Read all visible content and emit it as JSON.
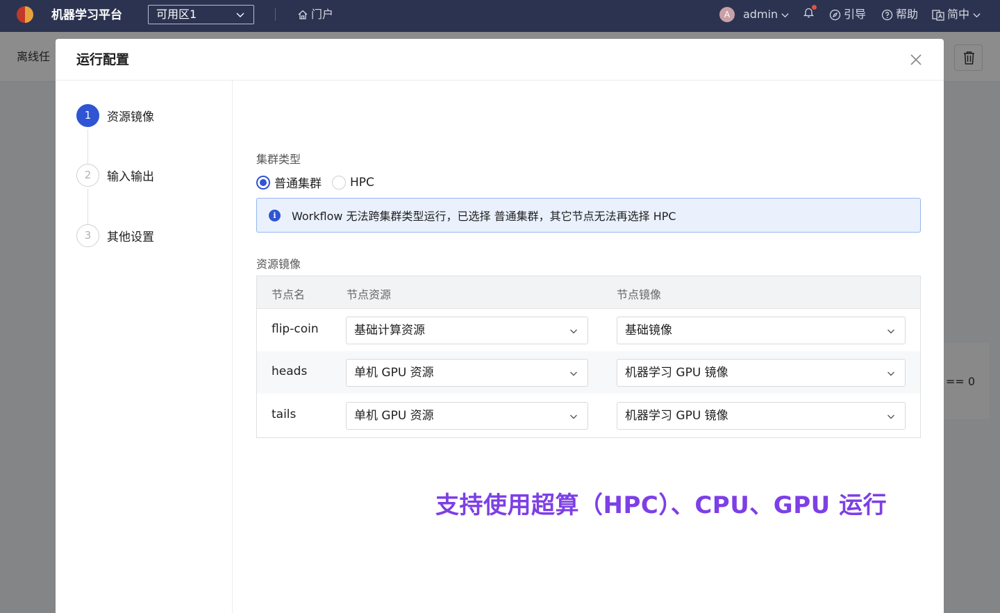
{
  "topbar": {
    "app_title": "机器学习平台",
    "zone": "可用区1",
    "portal": "门户",
    "user": "admin",
    "avatar_letter": "A",
    "guide": "引导",
    "help": "帮助",
    "language": "简中"
  },
  "background": {
    "page_title": "离线任",
    "code_fragment": "== 0"
  },
  "modal": {
    "title": "运行配置",
    "steps": [
      {
        "num": "1",
        "label": "资源镜像",
        "active": true
      },
      {
        "num": "2",
        "label": "输入输出",
        "active": false
      },
      {
        "num": "3",
        "label": "其他设置",
        "active": false
      }
    ],
    "cluster": {
      "label": "集群类型",
      "options": [
        {
          "label": "普通集群",
          "checked": true
        },
        {
          "label": "HPC",
          "checked": false
        }
      ],
      "alert": "Workflow 无法跨集群类型运行，已选择 普通集群，其它节点无法再选择 HPC"
    },
    "resources": {
      "label": "资源镜像",
      "columns": [
        "节点名",
        "节点资源",
        "节点镜像"
      ],
      "rows": [
        {
          "name": "flip-coin",
          "resource": "基础计算资源",
          "image": "基础镜像"
        },
        {
          "name": "heads",
          "resource": "单机 GPU 资源",
          "image": "机器学习 GPU 镜像"
        },
        {
          "name": "tails",
          "resource": "单机 GPU 资源",
          "image": "机器学习 GPU 镜像"
        }
      ]
    },
    "promo": "支持使用超算（HPC）、CPU、GPU 运行"
  },
  "colors": {
    "topbar": "#2b3350",
    "primary": "#2f54d4",
    "promo": "#7d3fe6",
    "alert_bg": "#eaf1fd"
  }
}
